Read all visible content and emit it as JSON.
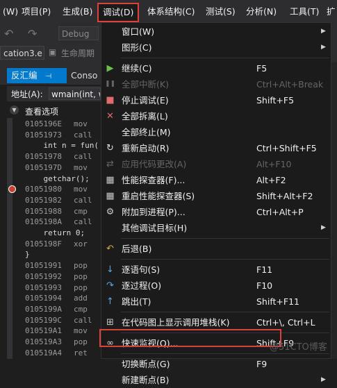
{
  "menubar": {
    "items": [
      "调试(D)",
      "体系结构(C)",
      "测试(S)",
      "分析(N)",
      "工具(T)"
    ],
    "left_items": [
      "(W)",
      "项目(P)",
      "生成(B)"
    ],
    "partial_right": "扩"
  },
  "toolbar": {
    "config_combo": "Debug",
    "project_combo": "cation3.e",
    "lifecycle_label": "生命周期"
  },
  "tabs": {
    "disasm": "反汇编",
    "pin": "⊣",
    "console": "Conso"
  },
  "address": {
    "label": "地址(A):",
    "value": "wmain(int, w"
  },
  "view_options": "查看选项",
  "code": [
    {
      "addr": "0105196E",
      "op": "mov"
    },
    {
      "addr": "01051973",
      "op": "call"
    },
    {
      "src": "    int n = fun("
    },
    {
      "addr": "01051978",
      "op": "call"
    },
    {
      "addr": "0105197D",
      "op": "mov"
    },
    {
      "src": "    getchar();"
    },
    {
      "addr": "01051980",
      "op": "mov"
    },
    {
      "addr": "01051982",
      "op": "call"
    },
    {
      "addr": "01051988",
      "op": "cmp"
    },
    {
      "addr": "0105198A",
      "op": "call"
    },
    {
      "src": "    return 0;"
    },
    {
      "addr": "0105198F",
      "op": "xor"
    },
    {
      "src": "}"
    },
    {
      "addr": "01051991",
      "op": "pop"
    },
    {
      "addr": "01051992",
      "op": "pop"
    },
    {
      "addr": "01051993",
      "op": "pop"
    },
    {
      "addr": "01051994",
      "op": "add"
    },
    {
      "addr": "0105199A",
      "op": "cmp"
    },
    {
      "addr": "0105199C",
      "op": "call"
    },
    {
      "addr": "010519A1",
      "op": "mov"
    },
    {
      "addr": "010519A3",
      "op": "pop"
    },
    {
      "addr": "010519A4",
      "op": "ret"
    }
  ],
  "menu": [
    {
      "label": "窗口(W)",
      "shortcut": "",
      "submenu": true,
      "icon": "",
      "disabled": false
    },
    {
      "label": "图形(C)",
      "shortcut": "",
      "submenu": true,
      "icon": "",
      "disabled": false
    },
    {
      "sep": true
    },
    {
      "label": "继续(C)",
      "shortcut": "F5",
      "icon": "play-icon",
      "disabled": false
    },
    {
      "label": "全部中断(K)",
      "shortcut": "Ctrl+Alt+Break",
      "icon": "pause-icon",
      "disabled": true
    },
    {
      "label": "停止调试(E)",
      "shortcut": "Shift+F5",
      "icon": "stop-icon",
      "disabled": false
    },
    {
      "label": "全部拆离(L)",
      "shortcut": "",
      "icon": "detach-icon",
      "disabled": false
    },
    {
      "label": "全部终止(M)",
      "shortcut": "",
      "icon": "",
      "disabled": false
    },
    {
      "label": "重新启动(R)",
      "shortcut": "Ctrl+Shift+F5",
      "icon": "restart-icon",
      "disabled": false
    },
    {
      "label": "应用代码更改(A)",
      "shortcut": "Alt+F10",
      "icon": "apply-changes-icon",
      "disabled": true
    },
    {
      "label": "性能探查器(F)...",
      "shortcut": "Alt+F2",
      "icon": "profiler-icon",
      "disabled": false
    },
    {
      "label": "重启性能探查器(S)",
      "shortcut": "Shift+Alt+F2",
      "icon": "profiler-restart-icon",
      "disabled": false
    },
    {
      "label": "附加到进程(P)...",
      "shortcut": "Ctrl+Alt+P",
      "icon": "attach-icon",
      "disabled": false
    },
    {
      "label": "其他调试目标(H)",
      "shortcut": "",
      "submenu": true,
      "icon": "",
      "disabled": false
    },
    {
      "sep": true
    },
    {
      "label": "后退(B)",
      "shortcut": "",
      "icon": "back-icon",
      "disabled": false
    },
    {
      "sep": true
    },
    {
      "label": "逐语句(S)",
      "shortcut": "F11",
      "icon": "step-into-icon",
      "disabled": false
    },
    {
      "label": "逐过程(O)",
      "shortcut": "F10",
      "icon": "step-over-icon",
      "disabled": false
    },
    {
      "label": "跳出(T)",
      "shortcut": "Shift+F11",
      "icon": "step-out-icon",
      "disabled": false
    },
    {
      "sep": true
    },
    {
      "label": "在代码图上显示调用堆栈(K)",
      "shortcut": "Ctrl+\\, Ctrl+L",
      "icon": "callstack-map-icon",
      "disabled": false
    },
    {
      "sep": true
    },
    {
      "label": "快速监视(Q)...",
      "shortcut": "Shift+F9",
      "icon": "glasses-icon",
      "disabled": false
    },
    {
      "sep": true
    },
    {
      "label": "切换断点(G)",
      "shortcut": "F9",
      "icon": "",
      "disabled": false
    },
    {
      "label": "新建断点(B)",
      "shortcut": "",
      "submenu": true,
      "icon": "",
      "disabled": false
    }
  ],
  "watermark": "@51CTO博客",
  "colors": {
    "highlight_border": "#e0403a",
    "tab_active": "#007acc",
    "menu_bg": "#1b1b1c"
  }
}
